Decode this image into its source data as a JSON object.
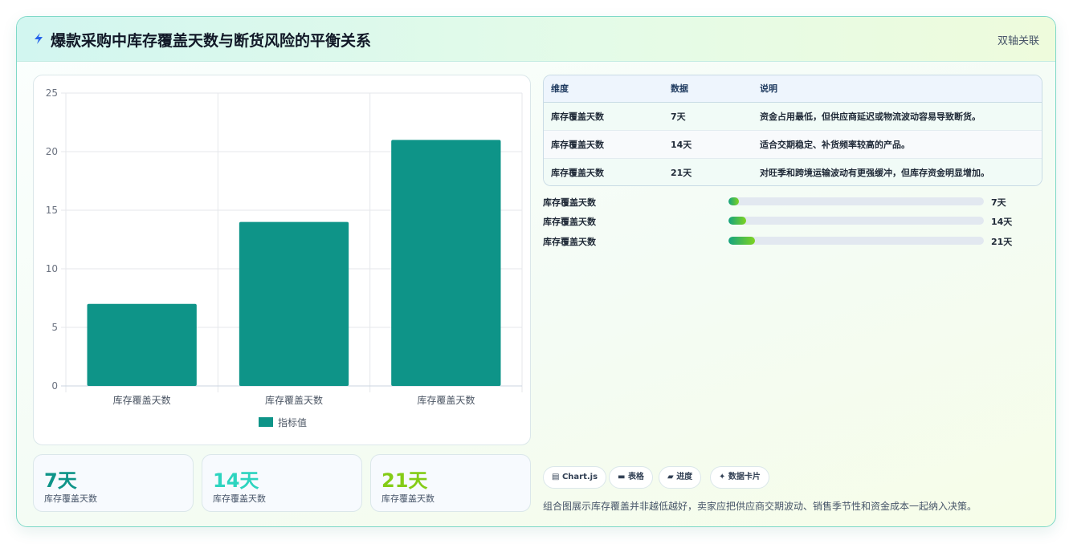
{
  "header": {
    "title": "爆款采购中库存覆盖天数与断货风险的平衡关系",
    "badge": "双轴关联"
  },
  "chart_data": {
    "type": "bar",
    "categories": [
      "库存覆盖天数",
      "库存覆盖天数",
      "库存覆盖天数"
    ],
    "series": [
      {
        "name": "指标值",
        "values": [
          7,
          14,
          21
        ],
        "color": "#0e9488"
      }
    ],
    "ylim": [
      0,
      25
    ],
    "yticks": [
      0,
      5,
      10,
      15,
      20,
      25
    ],
    "grid": true,
    "legend": "bottom"
  },
  "stats": [
    {
      "value": "7天",
      "label": "库存覆盖天数",
      "color": "#0e9488"
    },
    {
      "value": "14天",
      "label": "库存覆盖天数",
      "color": "#2dd4bf"
    },
    {
      "value": "21天",
      "label": "库存覆盖天数",
      "color": "#84cc16"
    }
  ],
  "table": {
    "headers": [
      "维度",
      "数据",
      "说明"
    ],
    "rows": [
      [
        "库存覆盖天数",
        "7天",
        "资金占用最低，但供应商延迟或物流波动容易导致断货。"
      ],
      [
        "库存覆盖天数",
        "14天",
        "适合交期稳定、补货频率较高的产品。"
      ],
      [
        "库存覆盖天数",
        "21天",
        "对旺季和跨境运输波动有更强缓冲，但库存资金明显增加。"
      ]
    ]
  },
  "progress": [
    {
      "label": "库存覆盖天数",
      "value": "7天",
      "fraction": 0.042
    },
    {
      "label": "库存覆盖天数",
      "value": "14天",
      "fraction": 0.07
    },
    {
      "label": "库存覆盖天数",
      "value": "21天",
      "fraction": 0.104
    }
  ],
  "tags": [
    {
      "icon": "bar-chart-icon",
      "label": "Chart.js"
    },
    {
      "icon": "table-icon",
      "label": "表格"
    },
    {
      "icon": "progress-icon",
      "label": "进度"
    },
    {
      "icon": "sparkle-icon",
      "label": "数据卡片"
    }
  ],
  "footnote": "组合图展示库存覆盖并非越低越好，卖家应把供应商交期波动、销售季节性和资金成本一起纳入决策。"
}
